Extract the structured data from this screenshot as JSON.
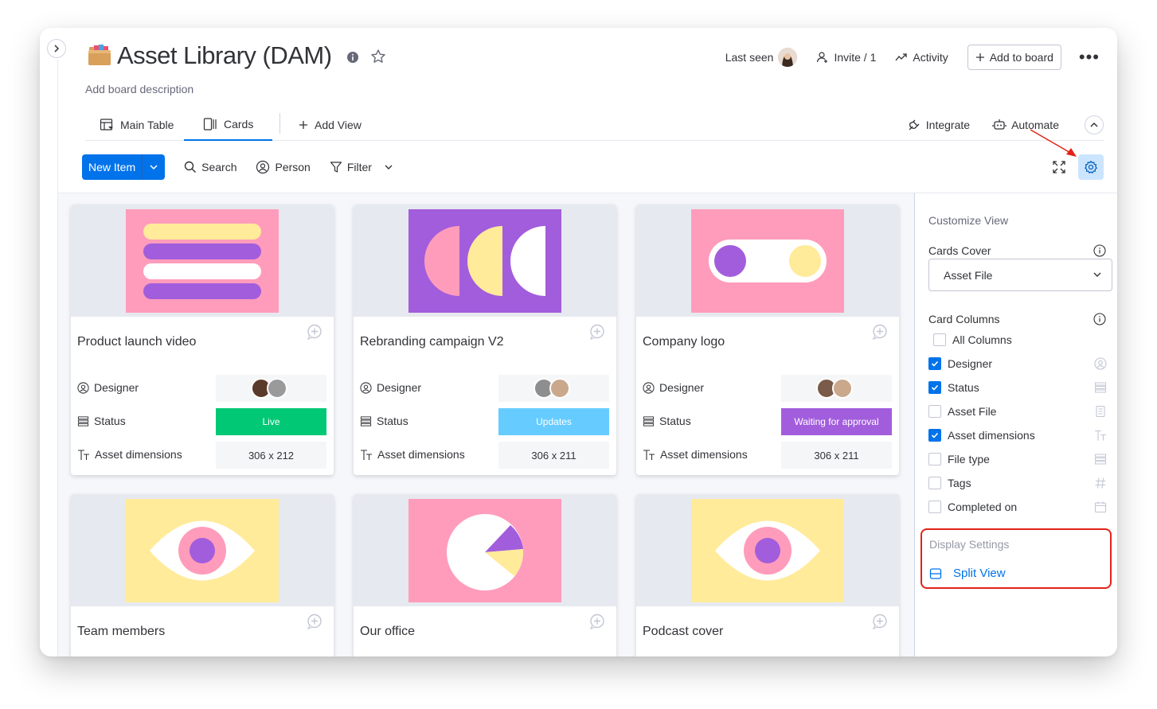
{
  "header": {
    "title": "Asset Library (DAM)",
    "description": "Add board description",
    "last_seen_label": "Last seen",
    "invite_label": "Invite / 1",
    "activity_label": "Activity",
    "add_to_board_label": "Add to board"
  },
  "tabs": {
    "main_table": "Main Table",
    "cards": "Cards",
    "add_view": "Add View",
    "integrate": "Integrate",
    "automate": "Automate"
  },
  "toolbar": {
    "new_item": "New Item",
    "search": "Search",
    "person": "Person",
    "filter": "Filter"
  },
  "labels": {
    "designer": "Designer",
    "status": "Status",
    "asset_dimensions": "Asset dimensions"
  },
  "cards": [
    {
      "name": "Product launch video",
      "status": "Live",
      "status_color": "#00c875",
      "dimensions": "306 x 212"
    },
    {
      "name": "Rebranding campaign V2",
      "status": "Updates",
      "status_color": "#66ccff",
      "dimensions": "306 x 211"
    },
    {
      "name": "Company logo",
      "status": "Waiting for approval",
      "status_color": "#a25ddc",
      "dimensions": "306 x 211"
    },
    {
      "name": "Team members"
    },
    {
      "name": "Our office"
    },
    {
      "name": "Podcast cover"
    }
  ],
  "panel": {
    "title": "Customize View",
    "cards_cover_label": "Cards Cover",
    "cards_cover_value": "Asset File",
    "card_columns_label": "Card Columns",
    "columns": [
      {
        "label": "All Columns",
        "checked": false,
        "icon": "none"
      },
      {
        "label": "Designer",
        "checked": true,
        "icon": "person-icon"
      },
      {
        "label": "Status",
        "checked": true,
        "icon": "lines-icon"
      },
      {
        "label": "Asset File",
        "checked": false,
        "icon": "file-icon"
      },
      {
        "label": "Asset dimensions",
        "checked": true,
        "icon": "text-icon"
      },
      {
        "label": "File type",
        "checked": false,
        "icon": "lines-icon"
      },
      {
        "label": "Tags",
        "checked": false,
        "icon": "hash-icon"
      },
      {
        "label": "Completed on",
        "checked": false,
        "icon": "calendar-icon"
      }
    ],
    "display_settings_label": "Display Settings",
    "split_view_label": "Split View"
  },
  "colors": {
    "accent": "#0073ea",
    "highlight_red": "#e2231a"
  }
}
